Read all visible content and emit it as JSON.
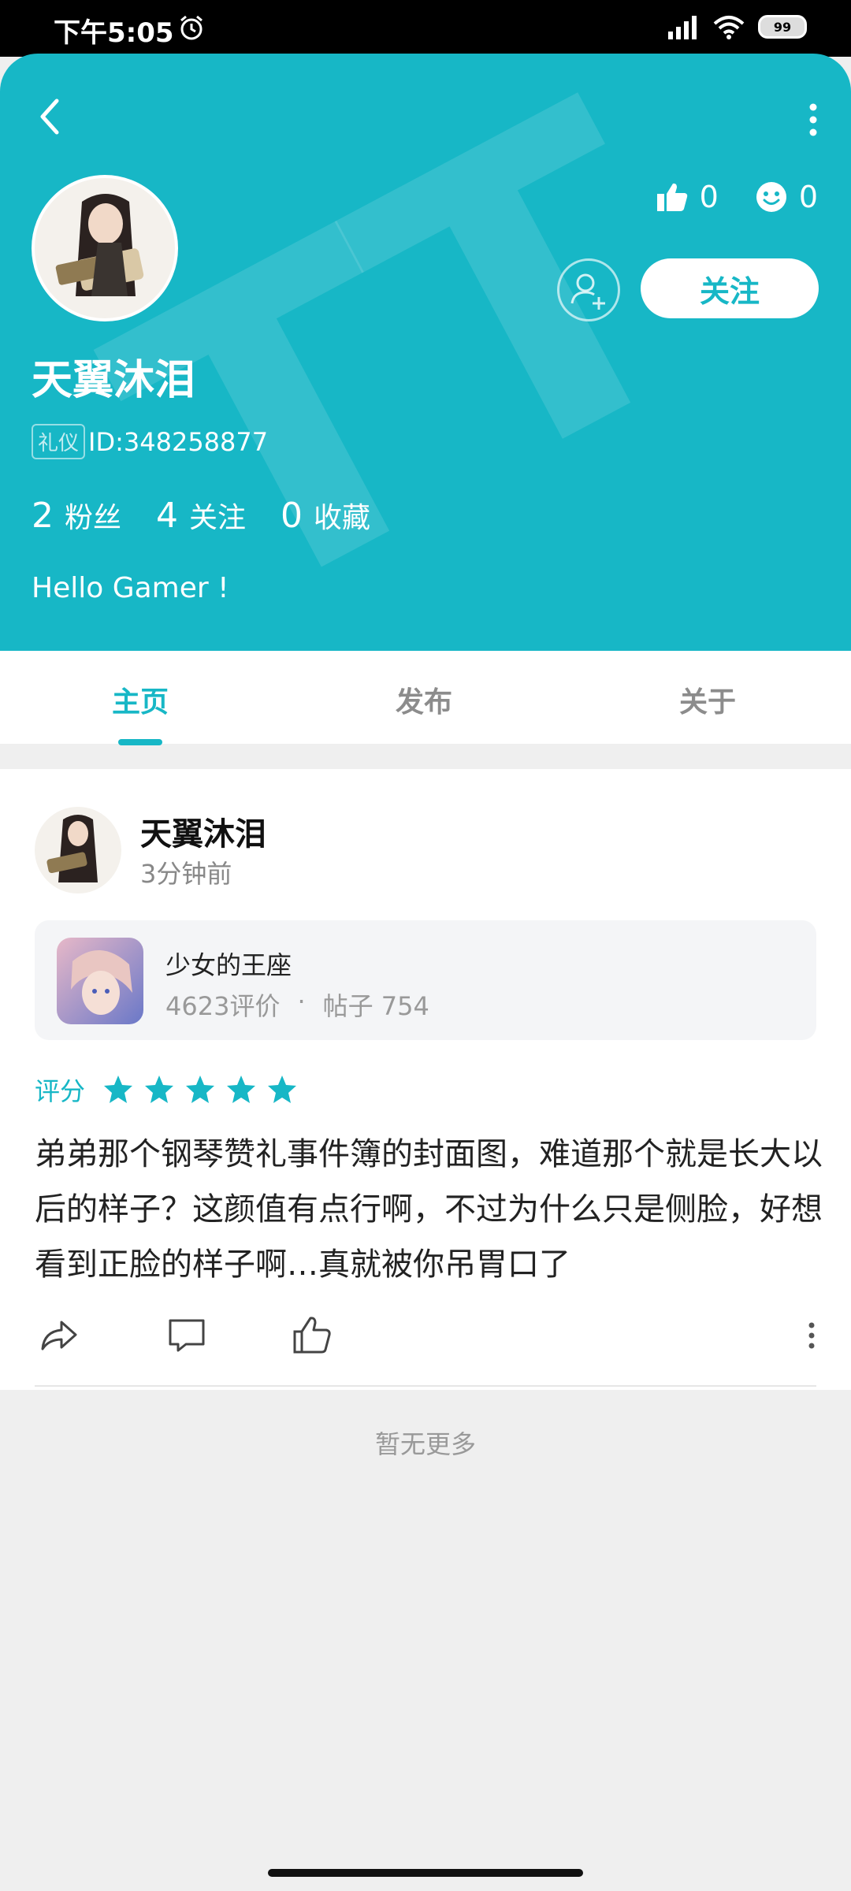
{
  "status_bar": {
    "time": "下午5:05",
    "battery": "99"
  },
  "profile": {
    "likes": "0",
    "smiles": "0",
    "follow_label": "关注",
    "username": "天翼沐泪",
    "badge": "礼仪",
    "id_text": "ID:348258877",
    "fans_count": "2",
    "fans_label": "粉丝",
    "following_count": "4",
    "following_label": "关注",
    "favorites_count": "0",
    "favorites_label": "收藏",
    "bio": "Hello Gamer !"
  },
  "tabs": [
    {
      "label": "主页",
      "active": true
    },
    {
      "label": "发布",
      "active": false
    },
    {
      "label": "关于",
      "active": false
    }
  ],
  "post": {
    "author": "天翼沐泪",
    "time": "3分钟前",
    "game": {
      "name": "少女的王座",
      "reviews": "4623评价",
      "separator": "·",
      "posts": "帖子 754"
    },
    "rating_label": "评分",
    "rating": 5,
    "text": "弟弟那个钢琴赞礼事件簿的封面图，难道那个就是长大以后的样子？这颜值有点行啊，不过为什么只是侧脸，好想看到正脸的样子啊…真就被你吊胃口了"
  },
  "footer": {
    "no_more": "暂无更多"
  },
  "colors": {
    "accent": "#17b7c6"
  }
}
